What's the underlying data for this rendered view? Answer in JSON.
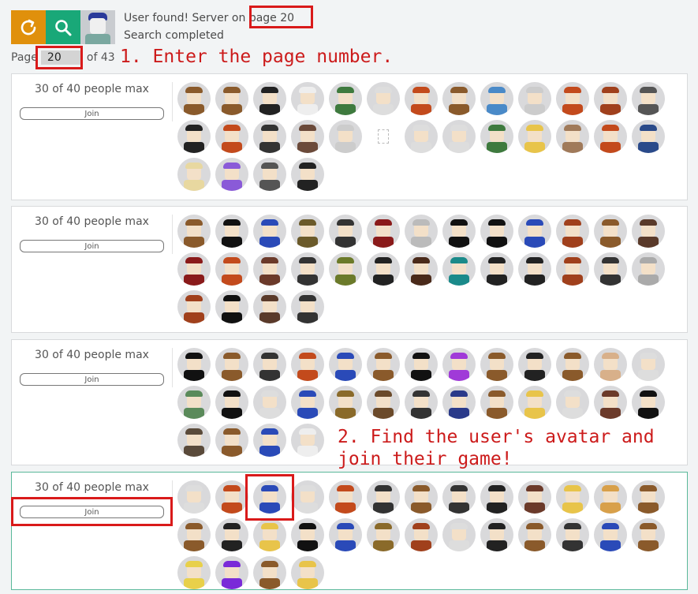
{
  "toolbar": {
    "refresh_icon": "refresh-icon",
    "search_icon": "search-icon",
    "colors": {
      "refresh": "#e0900c",
      "search": "#19a878"
    }
  },
  "status": {
    "line1_prefix": "User found! Server on ",
    "line1_highlight": "page 20",
    "line2": "Search completed"
  },
  "pager": {
    "label_before": "Page",
    "value": "20",
    "label_after": "of 43"
  },
  "annotations": {
    "step1": "1. Enter the page number.",
    "step2_line1": "2. Find the user's avatar and",
    "step2_line2": "join their game!"
  },
  "servers": [
    {
      "players_label": "30 of 40 people max",
      "join_label": "Join",
      "player_count": 30,
      "broken_avatar_index": 18,
      "avatar_colors": [
        "#8a5a2b",
        "#8a5a2b",
        "#222",
        "#eee",
        "#3e7a3e",
        "#ddd",
        "#c34a1c",
        "#8a5a2b",
        "#4a8ac8",
        "#ccc",
        "#c34a1c",
        "#a0401c",
        "#555",
        "#222",
        "#c34a1c",
        "#333",
        "#6b4a3a",
        "#ccc",
        "#ddd",
        "#ddd",
        "#ddd",
        "#3e7a3e",
        "#e8c44a",
        "#a07a5a",
        "#c34a1c",
        "#2a4a8a",
        "#e8d8a0",
        "#8a5ad8",
        "#555",
        "#222"
      ]
    },
    {
      "players_label": "30 of 40 people max",
      "join_label": "Join",
      "player_count": 30,
      "avatar_colors": [
        "#8a5a2b",
        "#111",
        "#2a4ab8",
        "#6b5a2a",
        "#333",
        "#8a1a1a",
        "#bbb",
        "#111",
        "#111",
        "#2a4ab8",
        "#a0401c",
        "#8a5a2b",
        "#5a3a2a",
        "#8a1a1a",
        "#c34a1c",
        "#6b3a2a",
        "#333",
        "#6b7a2a",
        "#222",
        "#4a2a1a",
        "#1a8a8a",
        "#222",
        "#222",
        "#a0401c",
        "#333",
        "#aaa",
        "#a0401c",
        "#111",
        "#5a3a2a",
        "#333"
      ]
    },
    {
      "players_label": "30 of 40 people max",
      "join_label": "Join",
      "player_count": 30,
      "avatar_colors": [
        "#111",
        "#8a5a2b",
        "#333",
        "#c34a1c",
        "#2a4ab8",
        "#8a5a2b",
        "#111",
        "#a03ad8",
        "#8a5a2b",
        "#222",
        "#8a5a2b",
        "#d8b08a",
        "#ddd",
        "#5a8a5a",
        "#111",
        "#ddd",
        "#2a4ab8",
        "#8a6a2a",
        "#6b4a2a",
        "#333",
        "#2a3a8a",
        "#8a5a2b",
        "#e8c44a",
        "#ddd",
        "#6b3a2a",
        "#111",
        "#5a4a3a",
        "#8a5a2b",
        "#2a4ab8",
        "#eee"
      ]
    },
    {
      "players_label": "30 of 40 people max",
      "join_label": "Join",
      "player_count": 30,
      "highlighted_avatar_index": 2,
      "avatar_colors": [
        "#ddd",
        "#c34a1c",
        "#2a4ab8",
        "#ddd",
        "#c34a1c",
        "#333",
        "#8a5a2b",
        "#333",
        "#222",
        "#6b3a2a",
        "#e8c44a",
        "#d8a04a",
        "#8a5a2b",
        "#8a5a2b",
        "#222",
        "#e8c44a",
        "#111",
        "#2a4ab8",
        "#8a6a2a",
        "#a0401c",
        "#ddd",
        "#222",
        "#8a5a2b",
        "#333",
        "#2a4ab8",
        "#8a5a2b",
        "#e8d04a",
        "#7a2ad8",
        "#8a5a2b",
        "#e8c44a"
      ]
    }
  ]
}
